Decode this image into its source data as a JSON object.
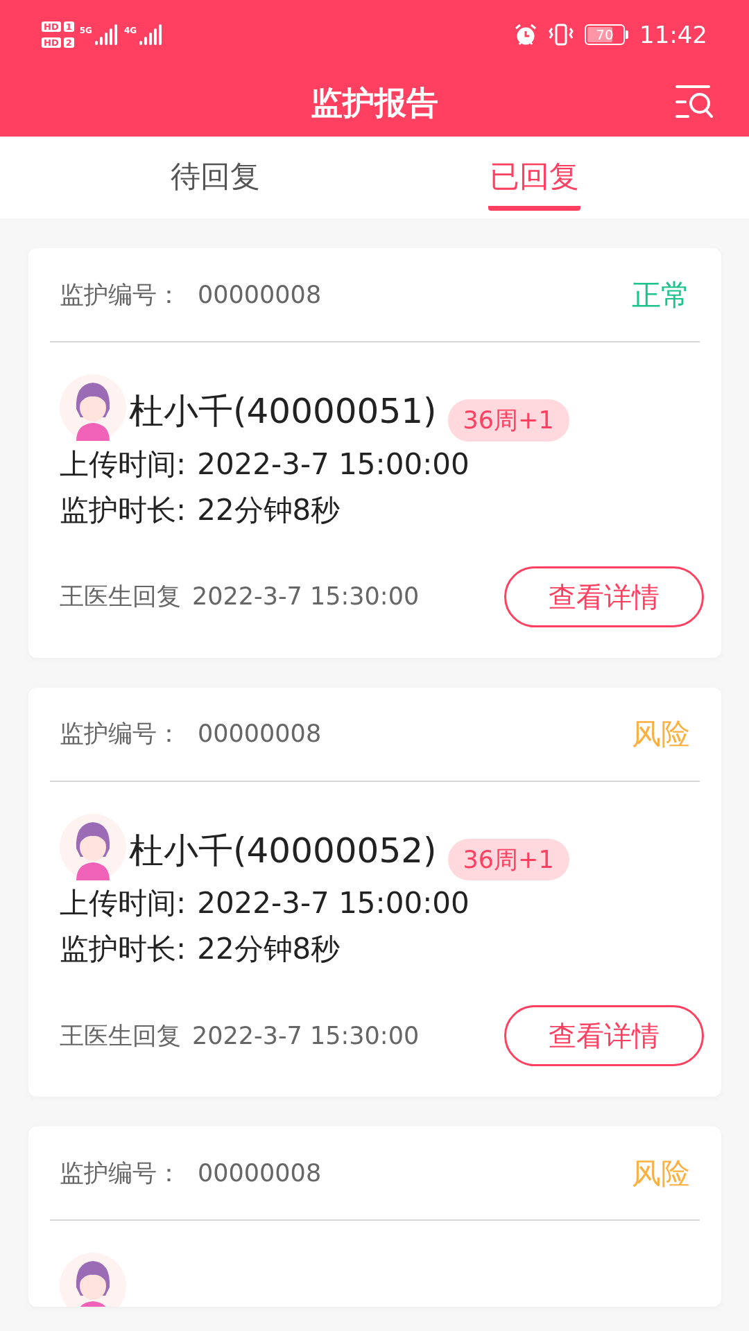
{
  "status_bar": {
    "sim_1": "HD",
    "sim_1_slot": "1",
    "sim_2": "HD",
    "sim_2_slot": "2",
    "network_1": "5G",
    "network_2": "4G",
    "battery": "70",
    "time": "11:42"
  },
  "header": {
    "title": "监护报告"
  },
  "tabs": [
    {
      "label": "待回复",
      "selected": false
    },
    {
      "label": "已回复",
      "selected": true
    }
  ],
  "reports": [
    {
      "id_label": "监护编号：",
      "id": "00000008",
      "status": "正常",
      "color": "#1ec28b",
      "name": "杜小千(40000051)",
      "week": "36周+1",
      "upload_label": "上传时间:",
      "upload_time": "2022-3-7  15:00:00",
      "duration_label": "监护时长:",
      "duration": "22分钟8秒",
      "reply": "王医生回复",
      "reply_time": "2022-3-7  15:30:00",
      "button": "查看详情"
    },
    {
      "id_label": "监护编号：",
      "id": "00000008",
      "status": "风险",
      "color": "#fbb040",
      "name": "杜小千(40000052)",
      "week": "36周+1",
      "upload_label": "上传时间:",
      "upload_time": "2022-3-7  15:00:00",
      "duration_label": "监护时长:",
      "duration": "22分钟8秒",
      "reply": "王医生回复",
      "reply_time": "2022-3-7  15:30:00",
      "button": "查看详情"
    },
    {
      "id_label": "监护编号：",
      "id": "00000008",
      "status": "风险",
      "color": "#fbb040",
      "kind": "cut"
    }
  ]
}
